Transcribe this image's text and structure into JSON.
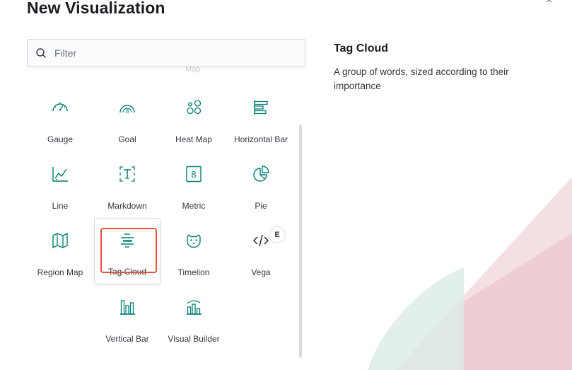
{
  "dialog": {
    "title": "New Visualization",
    "close_glyph": "×"
  },
  "filter": {
    "placeholder": "Filter",
    "value": ""
  },
  "grid": {
    "cut_off_label": "Map",
    "items": [
      {
        "label": "Gauge",
        "icon": "gauge-icon"
      },
      {
        "label": "Goal",
        "icon": "goal-icon"
      },
      {
        "label": "Heat Map",
        "icon": "heat-map-icon"
      },
      {
        "label": "Horizontal Bar",
        "icon": "horizontal-bar-icon"
      },
      {
        "label": "Line",
        "icon": "line-chart-icon"
      },
      {
        "label": "Markdown",
        "icon": "markdown-icon"
      },
      {
        "label": "Metric",
        "icon": "metric-icon"
      },
      {
        "label": "Pie",
        "icon": "pie-chart-icon"
      },
      {
        "label": "Region Map",
        "icon": "region-map-icon"
      },
      {
        "label": "Tag Cloud",
        "icon": "tag-cloud-icon",
        "selected": true
      },
      {
        "label": "Timelion",
        "icon": "timelion-icon"
      },
      {
        "label": "Vega",
        "icon": "vega-icon",
        "badge": "E"
      },
      {
        "label": "Vertical Bar",
        "icon": "vertical-bar-icon"
      },
      {
        "label": "Visual Builder",
        "icon": "visual-builder-icon"
      }
    ]
  },
  "description": {
    "title": "Tag Cloud",
    "text": "A group of words, sized according to their importance"
  },
  "colors": {
    "icon_green": "#017d73",
    "highlight_red": "#e5533a",
    "bg_pink": "#f4dbe1",
    "bg_mint": "#e0ede8"
  }
}
